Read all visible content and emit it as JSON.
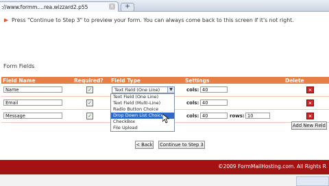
{
  "browser": {
    "tab_title": "://www.formm....rea.wizzard2.p55",
    "new_tab_symbol": "+",
    "close_symbol": "x"
  },
  "instructions": {
    "partial_top": "",
    "text": "Press \"Continue to Step 3\" to preview your form. You can always come back to this screen if it's not right."
  },
  "section_title": "Form Fields",
  "table": {
    "headers": {
      "field_name": "Field Name",
      "required": "Required?",
      "field_type": "Field Type",
      "settings": "Settings",
      "delete": "Delete"
    },
    "rows": [
      {
        "name": "Name",
        "required": true,
        "type": "Text Field (One Line)",
        "cols_label": "cols:",
        "cols": "40"
      },
      {
        "name": "Email",
        "required": true,
        "type": "Text Field (One Line)",
        "cols_label": "cols:",
        "cols": "40"
      },
      {
        "name": "Message",
        "required": true,
        "type": "Drop Down List Choice",
        "cols_label": "cols:",
        "cols": "40",
        "rows_label": "rows:",
        "rows": "10"
      }
    ]
  },
  "dropdown_options": [
    "Text Field (One Line)",
    "Text Field (Multi-Line)",
    "Radio Button Choice",
    "Drop Down List Choice",
    "CheckBox",
    "File Upload"
  ],
  "dropdown_highlighted": "Drop Down List Choice",
  "buttons": {
    "add_new_field": "Add New Field",
    "back": "< Back",
    "continue": "Continue to Step 3"
  },
  "footer": {
    "text": "©2009 FormMailHosting.com. All Rights R"
  },
  "colors": {
    "header_orange": "#e67e45",
    "footer_red": "#a41313",
    "highlight_blue": "#3169c6"
  }
}
